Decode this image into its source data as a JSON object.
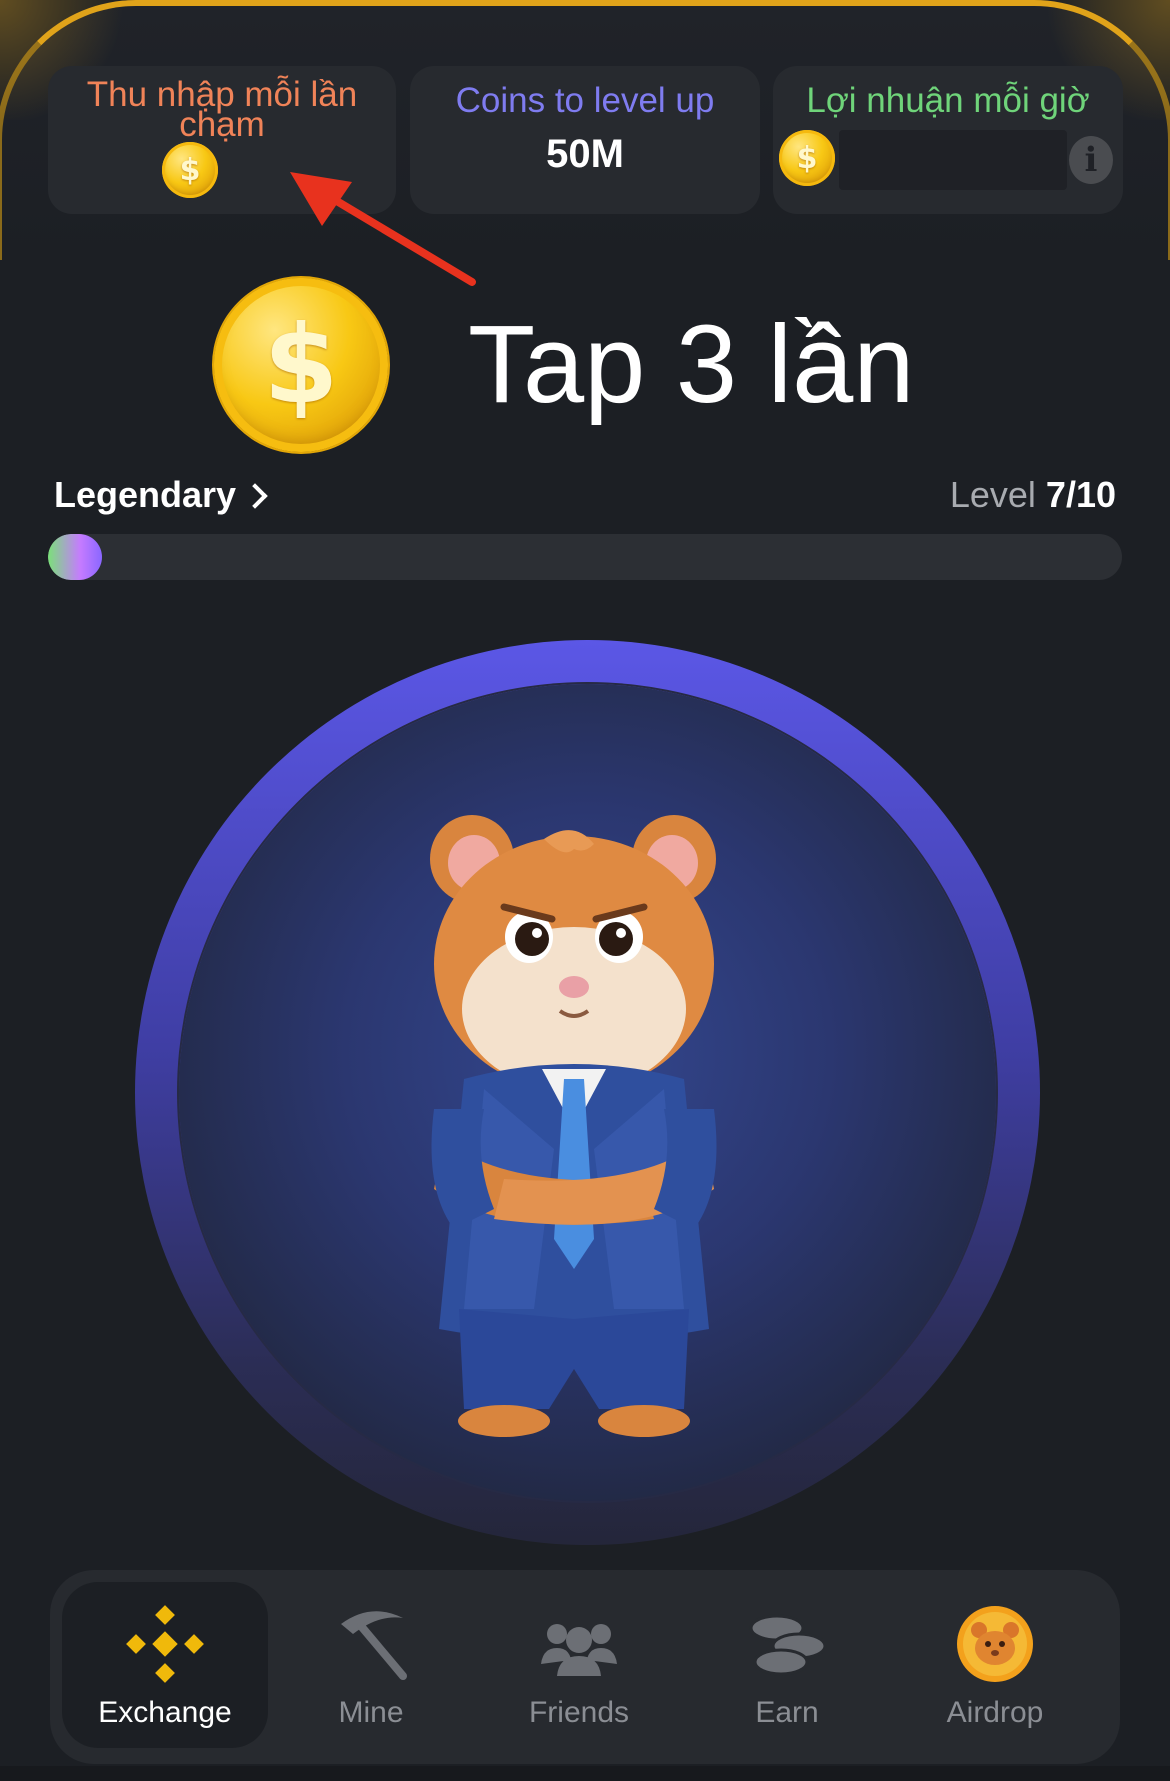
{
  "stats": {
    "earn_per_tap": {
      "label": "Thu nhập mỗi lần chạm",
      "value": ""
    },
    "coins_to_level": {
      "label": "Coins to level up",
      "value": "50M"
    },
    "profit_per_hour": {
      "label": "Lợi nhuận mỗi giờ",
      "value": ""
    }
  },
  "overlay": {
    "tap_text": "Tap 3 lần"
  },
  "league": {
    "name": "Legendary",
    "level_prefix": "Level",
    "level_value": "7/10",
    "progress": 0.05
  },
  "icons": {
    "coin": "$",
    "info": "i"
  },
  "nav": {
    "items": [
      {
        "label": "Exchange",
        "icon": "exchange-icon",
        "active": true
      },
      {
        "label": "Mine",
        "icon": "pickaxe-icon",
        "active": false
      },
      {
        "label": "Friends",
        "icon": "friends-icon",
        "active": false
      },
      {
        "label": "Earn",
        "icon": "coins-stack-icon",
        "active": false
      },
      {
        "label": "Airdrop",
        "icon": "hamster-coin-icon",
        "active": false
      }
    ]
  },
  "colors": {
    "accent_gold": "#f8c814",
    "earn_per_tap_label": "#f08358",
    "coins_to_level_label": "#7f7cf0",
    "profit_label": "#6fd47a",
    "annotation_red": "#e8321e",
    "ring_blue": "#5b57e6"
  }
}
